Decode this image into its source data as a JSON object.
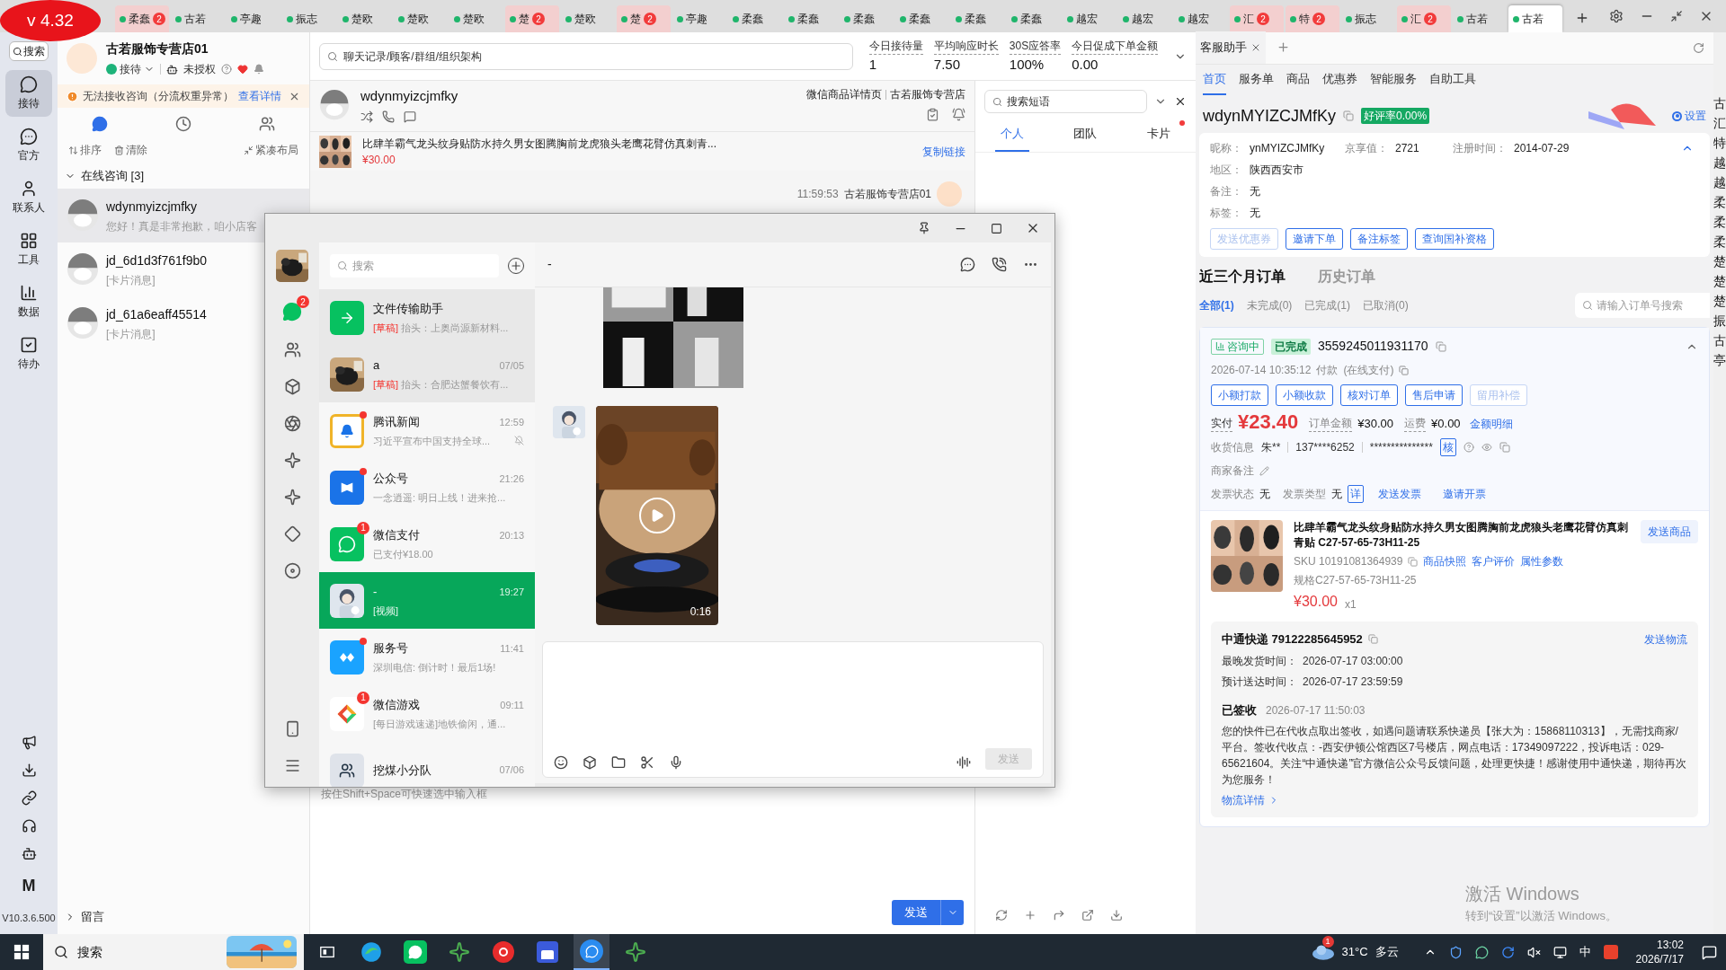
{
  "version_badge": "v 4.32",
  "top_tabs": [
    {
      "label": "柔蠢",
      "badge": "2",
      "selected": false
    },
    {
      "label": "古若",
      "selected": false
    },
    {
      "label": "亭趣",
      "selected": false
    },
    {
      "label": "振志",
      "selected": false
    },
    {
      "label": "楚欧",
      "selected": false
    },
    {
      "label": "楚欧",
      "selected": false
    },
    {
      "label": "楚欧",
      "selected": false
    },
    {
      "label": "楚",
      "badge": "2",
      "selected": false
    },
    {
      "label": "楚欧",
      "selected": false
    },
    {
      "label": "楚",
      "badge": "2",
      "selected": false
    },
    {
      "label": "亭趣",
      "selected": false
    },
    {
      "label": "柔蠢",
      "selected": false
    },
    {
      "label": "柔蠢",
      "selected": false
    },
    {
      "label": "柔蠢",
      "selected": false
    },
    {
      "label": "柔蠢",
      "selected": false
    },
    {
      "label": "柔蠢",
      "selected": false
    },
    {
      "label": "柔蠢",
      "selected": false
    },
    {
      "label": "越宏",
      "selected": false
    },
    {
      "label": "越宏",
      "selected": false
    },
    {
      "label": "越宏",
      "selected": false
    },
    {
      "label": "汇",
      "badge": "2",
      "selected": false
    },
    {
      "label": "特",
      "badge": "2",
      "selected": false
    },
    {
      "label": "振志",
      "selected": false
    },
    {
      "label": "汇",
      "badge": "2",
      "selected": false
    },
    {
      "label": "古若",
      "selected": false
    },
    {
      "label": "古若",
      "selected": true
    }
  ],
  "nav": {
    "search": "搜索",
    "items": [
      {
        "label": "接待",
        "kind": "chat",
        "selected": true
      },
      {
        "label": "官方",
        "kind": "official",
        "selected": false
      },
      {
        "label": "联系人",
        "kind": "contact",
        "selected": false
      },
      {
        "label": "工具",
        "kind": "tools",
        "selected": false
      },
      {
        "label": "数据",
        "kind": "data",
        "selected": false
      },
      {
        "label": "待办",
        "kind": "todo",
        "selected": false
      }
    ],
    "bottom_mark": "M",
    "version": "V10.3.6.500"
  },
  "shop": {
    "name": "古若服饰专营店01",
    "status": "接待",
    "auth": "未授权"
  },
  "alert": {
    "text": "无法接收咨询（分流权重异常）",
    "link": "查看详情"
  },
  "list_tools": [
    "排序",
    "清除",
    "紧凑布局"
  ],
  "online_group": {
    "label": "在线咨询 [3]",
    "expanded": true,
    "items": [
      {
        "name": "wdynmyizcjmfky",
        "preview": "您好！真是非常抱歉，咱小店客",
        "selected": true
      },
      {
        "name": "jd_6d1d3f761f9b0",
        "preview": "[卡片消息]",
        "selected": false
      },
      {
        "name": "jd_61a6eaff45514",
        "preview": "[卡片消息]",
        "selected": false
      }
    ]
  },
  "message_group": {
    "label": "留言",
    "expanded": false
  },
  "search": {
    "placeholder": "聊天记录/顾客/群组/组织架构"
  },
  "stats": [
    {
      "label": "今日接待量",
      "value": "1"
    },
    {
      "label": "平均响应时长",
      "value": "7.50"
    },
    {
      "label": "30S应答率",
      "value": "100%"
    },
    {
      "label": "今日促成下单金额",
      "value": "0.00"
    }
  ],
  "conversation": {
    "name": "wdynmyizcjmfky",
    "links": [
      "微信商品详情页",
      "古若服饰专营店"
    ],
    "product": {
      "title": "比肆羊霸气龙头纹身贴防水持久男女图腾胸前龙虎狼头老鹰花臂仿真刺青...",
      "price": "¥30.00",
      "action": "复制链接"
    },
    "message_time": "11:59:53",
    "message_sender": "古若服饰专营店01",
    "input_hint": "按住Shift+Space可快速选中输入框",
    "send": "发送"
  },
  "phrases": {
    "placeholder": "搜索短语",
    "tabs": [
      {
        "label": "个人",
        "selected": true,
        "dot": false
      },
      {
        "label": "团队",
        "selected": false,
        "dot": false
      },
      {
        "label": "卡片",
        "selected": false,
        "dot": true
      }
    ]
  },
  "wechat": {
    "search": "搜索",
    "rail_badge": "2",
    "chat_title": "-",
    "video_duration": "0:16",
    "send": "发送",
    "chats": [
      {
        "name": "文件传输助手",
        "draft": "[草稿]",
        "preview": "抬头：上奥尚源新材料...",
        "kind": "file",
        "pinned": true,
        "dot": false,
        "muted": false,
        "selected": false
      },
      {
        "name": "a",
        "draft": "[草稿]",
        "preview": "抬头：合肥达蟹餐饮有...",
        "time": "07/05",
        "kind": "pet",
        "pinned": true,
        "dot": false,
        "muted": false,
        "selected": false
      },
      {
        "name": "腾讯新闻",
        "preview": "习近平宣布中国支持全球...",
        "time": "12:59",
        "kind": "news",
        "pinned": false,
        "dot": true,
        "muted": true,
        "selected": false
      },
      {
        "name": "公众号",
        "preview": "一念逍遥: 明日上线！进来抢...",
        "time": "21:26",
        "kind": "official",
        "pinned": false,
        "dot": true,
        "muted": false,
        "selected": false
      },
      {
        "name": "微信支付",
        "badge": "1",
        "preview": "已支付¥18.00",
        "time": "20:13",
        "kind": "pay",
        "pinned": false,
        "dot": false,
        "muted": false,
        "selected": false
      },
      {
        "name": "-",
        "preview": "[视频]",
        "time": "19:27",
        "kind": "kid",
        "pinned": false,
        "dot": false,
        "muted": false,
        "selected": true
      },
      {
        "name": "服务号",
        "preview": "深圳电信: 倒计时！最后1场!",
        "time": "11:41",
        "kind": "service",
        "pinned": false,
        "dot": true,
        "muted": false,
        "selected": false
      },
      {
        "name": "微信游戏",
        "badge": "1",
        "preview": "[每日游戏速递]地铁偷闲，通...",
        "time": "09:11",
        "kind": "game",
        "pinned": false,
        "dot": false,
        "muted": false,
        "selected": false
      },
      {
        "name": "挖煤小分队",
        "time": "07/06",
        "kind": "group",
        "pinned": false,
        "dot": false,
        "muted": false,
        "selected": false
      }
    ]
  },
  "assistant": {
    "tab": "客服助手",
    "nav": [
      {
        "label": "首页",
        "selected": true
      },
      {
        "label": "服务单",
        "selected": false
      },
      {
        "label": "商品",
        "selected": false
      },
      {
        "label": "优惠券",
        "selected": false
      },
      {
        "label": "智能服务",
        "selected": false
      },
      {
        "label": "自助工具",
        "selected": false
      }
    ],
    "customer": "wdynMYIZCJMfKy",
    "rating": "好评率0.00%",
    "settings": "设置",
    "info": [
      {
        "label": "昵称：",
        "value": "ynMYIZCJMfKy"
      },
      {
        "label": "京享值：",
        "value": "2721"
      },
      {
        "label": "注册时间：",
        "value": "2014-07-29"
      },
      {
        "label": "地区：",
        "value": "陕西西安市"
      },
      {
        "label": "备注：",
        "value": "无"
      },
      {
        "label": "标签：",
        "value": "无"
      }
    ],
    "actions": [
      {
        "label": "发送优惠券",
        "disabled": true
      },
      {
        "label": "邀请下单",
        "disabled": false
      },
      {
        "label": "备注标签",
        "disabled": false
      },
      {
        "label": "查询国补资格",
        "disabled": false
      }
    ],
    "order_tabs": [
      {
        "label": "近三个月订单",
        "selected": true
      },
      {
        "label": "历史订单",
        "selected": false
      }
    ],
    "filters": [
      {
        "label": "全部(1)",
        "selected": true
      },
      {
        "label": "未完成(0)",
        "selected": false
      },
      {
        "label": "已完成(1)",
        "selected": false
      },
      {
        "label": "已取消(0)",
        "selected": false
      }
    ],
    "order_search": "请输入订单号搜索",
    "order": {
      "consult_tag": "咨询中",
      "status_tag": "已完成",
      "number": "3559245011931170",
      "paid_time": "2026-07-14 10:35:12",
      "paid_label": "付款",
      "pay_method": "(在线支付)",
      "buttons": [
        {
          "label": "小额打款",
          "disabled": false
        },
        {
          "label": "小额收款",
          "disabled": false
        },
        {
          "label": "核对订单",
          "disabled": false
        },
        {
          "label": "售后申请",
          "disabled": false
        },
        {
          "label": "留用补偿",
          "disabled": true
        }
      ],
      "paid_label2": "实付",
      "paid": "¥23.40",
      "total_label": "订单金额",
      "total": "¥30.00",
      "ship_label": "运费",
      "ship": "¥0.00",
      "detail_link": "金额明细",
      "receiver_label": "收货信息",
      "receiver": "朱**",
      "phone": "137****6252",
      "address": "***************",
      "verify": "核",
      "note_label": "商家备注",
      "invoice_status_label": "发票状态",
      "invoice_status": "无",
      "invoice_type_label": "发票类型",
      "invoice_type": "无",
      "invoice_detail": "详",
      "send_invoice": "发送发票",
      "invite_invoice": "邀请开票",
      "item": {
        "title": "比肆羊霸气龙头纹身贴防水持久男女图腾胸前龙虎狼头老鹰花臂仿真刺青贴 C27-57-65-73H11-25",
        "sku": "SKU 10191081364939",
        "links": [
          "商品快照",
          "客户评价",
          "属性参数"
        ],
        "spec": "规格C27-57-65-73H11-25",
        "price": "¥30.00",
        "qty": "x1",
        "send": "发送商品"
      },
      "logistics": {
        "title": "中通快递 79122285645952",
        "send": "发送物流",
        "rows": [
          {
            "label": "最晚发货时间：",
            "value": "2026-07-17 03:00:00"
          },
          {
            "label": "预计送达时间：",
            "value": "2026-07-17 23:59:59"
          }
        ],
        "state": "已签收",
        "state_time": "2026-07-17 11:50:03",
        "text": "您的快件已在代收点取出签收，如遇问题请联系快递员【张大为：15868110313】，无需找商家/平台。签收代收点：-西安伊顿公馆西区7号楼店，网点电话：17349097222，投诉电话：029-65621604。关注“中通快递”官方微信公众号反馈问题，处理更快捷！感谢使用中通快递，期待再次为您服务！",
        "more": "物流详情"
      }
    }
  },
  "edge_strip": [
    "古",
    "汇",
    "特",
    "越",
    "越",
    "柔",
    "柔",
    "柔",
    "楚",
    "楚",
    "楚",
    "振",
    "古",
    "亭"
  ],
  "activation": {
    "title": "激活 Windows",
    "hint": "转到“设置”以激活 Windows。"
  },
  "taskbar": {
    "search": "搜索",
    "apps": [
      {
        "kind": "taskview",
        "active": false
      },
      {
        "kind": "browser",
        "active": false
      },
      {
        "kind": "wechat",
        "active": false
      },
      {
        "kind": "star",
        "active": false
      },
      {
        "kind": "record",
        "active": false
      },
      {
        "kind": "m",
        "active": false
      },
      {
        "kind": "bubble",
        "active": true
      },
      {
        "kind": "star",
        "active": false
      }
    ],
    "weather_badge": "1",
    "temp": "31°C",
    "weather": "多云",
    "ime": "中",
    "time": "13:02",
    "date": "2026/7/17"
  }
}
